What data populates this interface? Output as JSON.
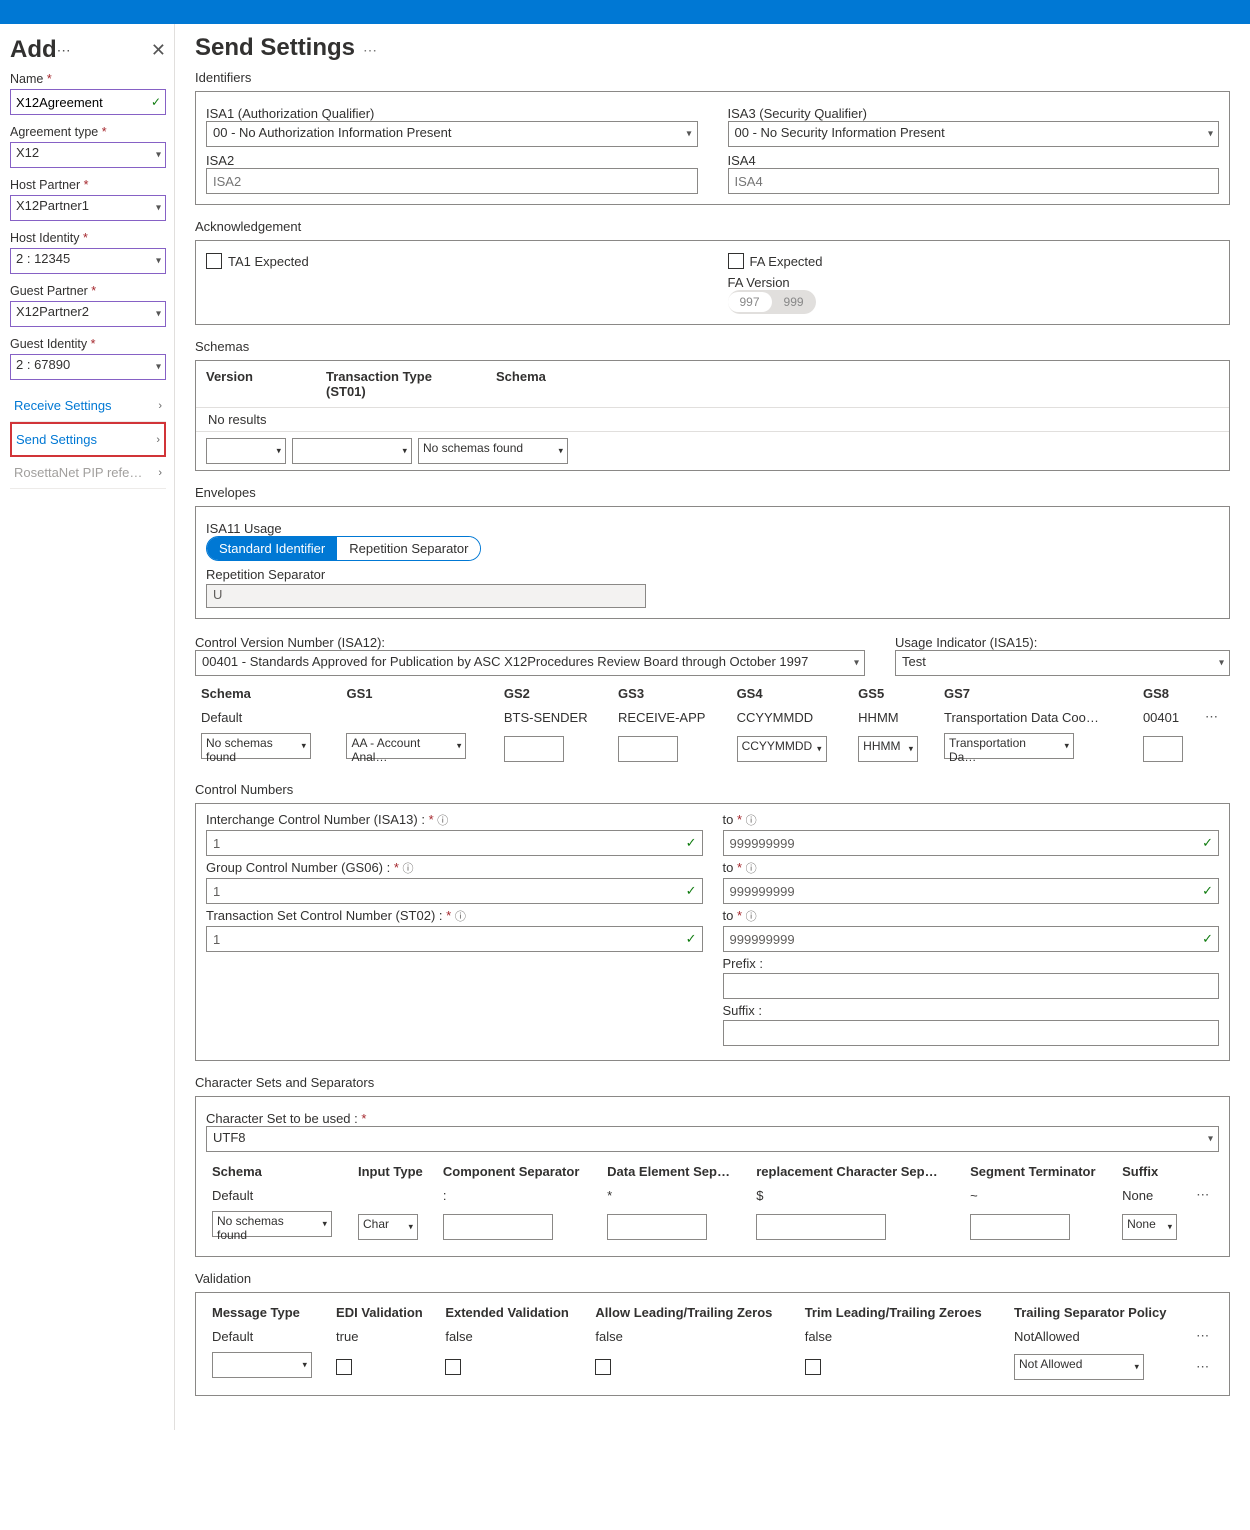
{
  "sidebar": {
    "title": "Add",
    "name_label": "Name",
    "name_value": "X12Agreement",
    "type_label": "Agreement type",
    "type_value": "X12",
    "host_partner_label": "Host Partner",
    "host_partner_value": "X12Partner1",
    "host_identity_label": "Host Identity",
    "host_identity_value": "2 : 12345",
    "guest_partner_label": "Guest Partner",
    "guest_partner_value": "X12Partner2",
    "guest_identity_label": "Guest Identity",
    "guest_identity_value": "2 : 67890",
    "nav": {
      "receive": "Receive Settings",
      "send": "Send Settings",
      "rosetta": "RosettaNet PIP references"
    }
  },
  "page": {
    "title": "Send Settings"
  },
  "identifiers": {
    "title": "Identifiers",
    "isa1_label": "ISA1 (Authorization Qualifier)",
    "isa1_value": "00 - No Authorization Information Present",
    "isa3_label": "ISA3 (Security Qualifier)",
    "isa3_value": "00 - No Security Information Present",
    "isa2_label": "ISA2",
    "isa2_placeholder": "ISA2",
    "isa4_label": "ISA4",
    "isa4_placeholder": "ISA4"
  },
  "ack": {
    "title": "Acknowledgement",
    "ta1": "TA1 Expected",
    "fa": "FA Expected",
    "fa_version": "FA Version",
    "v997": "997",
    "v999": "999"
  },
  "schemas": {
    "title": "Schemas",
    "h_version": "Version",
    "h_txn": "Transaction Type (ST01)",
    "h_schema": "Schema",
    "no_results": "No results",
    "no_schemas": "No schemas found"
  },
  "envelopes": {
    "title": "Envelopes",
    "isa11": "ISA11 Usage",
    "std_id": "Standard Identifier",
    "rep_sep": "Repetition Separator",
    "rep_sep_label": "Repetition Separator",
    "rep_sep_val": "U",
    "cvn_label": "Control Version Number (ISA12):",
    "cvn_value": "00401 - Standards Approved for Publication by ASC X12Procedures Review Board through October 1997",
    "usage_label": "Usage Indicator (ISA15):",
    "usage_value": "Test",
    "cols": {
      "schema": "Schema",
      "gs1": "GS1",
      "gs2": "GS2",
      "gs3": "GS3",
      "gs4": "GS4",
      "gs5": "GS5",
      "gs7": "GS7",
      "gs8": "GS8"
    },
    "default_row": {
      "schema": "Default",
      "gs2": "BTS-SENDER",
      "gs3": "RECEIVE-APP",
      "gs4": "CCYYMMDD",
      "gs5": "HHMM",
      "gs7": "Transportation Data Coo…",
      "gs8": "00401"
    },
    "edit_row": {
      "schema": "No schemas found",
      "gs1": "AA - Account Anal…",
      "gs4": "CCYYMMDD",
      "gs5": "HHMM",
      "gs7": "Transportation Da…"
    }
  },
  "control": {
    "title": "Control Numbers",
    "icn_label": "Interchange Control Number (ISA13) :",
    "gcn_label": "Group Control Number (GS06) :",
    "tscn_label": "Transaction Set Control Number (ST02) :",
    "to_label": "to",
    "from_val": "1",
    "to_val": "999999999",
    "prefix": "Prefix :",
    "suffix": "Suffix :"
  },
  "charset": {
    "title": "Character Sets and Separators",
    "cs_label": "Character Set to be used :",
    "cs_value": "UTF8",
    "cols": {
      "schema": "Schema",
      "input": "Input Type",
      "comp": "Component Separator",
      "data": "Data Element Sep…",
      "repl": "replacement Character Sep…",
      "seg": "Segment Terminator",
      "suffix": "Suffix"
    },
    "default_row": {
      "schema": "Default",
      "comp": ":",
      "data": "*",
      "repl": "$",
      "seg": "~",
      "suffix": "None"
    },
    "edit_row": {
      "schema": "No schemas found",
      "input": "Char",
      "suffix": "None"
    }
  },
  "validation": {
    "title": "Validation",
    "cols": {
      "msg": "Message Type",
      "edi": "EDI Validation",
      "ext": "Extended Validation",
      "lead": "Allow Leading/Trailing Zeros",
      "trim": "Trim Leading/Trailing Zeroes",
      "trail": "Trailing Separator Policy"
    },
    "default_row": {
      "msg": "Default",
      "edi": "true",
      "ext": "false",
      "lead": "false",
      "trim": "false",
      "trail": "NotAllowed"
    },
    "edit_trail": "Not Allowed"
  }
}
